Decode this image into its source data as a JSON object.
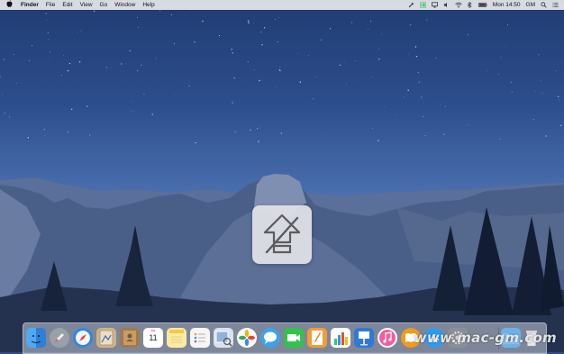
{
  "menubar": {
    "apple_glyph": "",
    "items": [
      "Finder",
      "File",
      "Edit",
      "View",
      "Go",
      "Window",
      "Help"
    ],
    "clock": "Mon 14:50",
    "user": "GM",
    "status_icons": [
      "tool-icon",
      "sidebar-app-icon",
      "airplay-icon",
      "volume-icon",
      "wifi-icon",
      "bluetooth-icon",
      "battery-icon"
    ]
  },
  "hud": {
    "icon": "upload-disabled-icon"
  },
  "dock": {
    "apps": [
      "finder",
      "launchpad",
      "safari",
      "mail-stamp",
      "contacts",
      "calendar",
      "notes",
      "reminders",
      "preview",
      "photos",
      "messages",
      "facetime",
      "pages",
      "numbers",
      "keynote",
      "itunes",
      "ibooks",
      "app-store",
      "system-preferences",
      "downloads-folder",
      "trash"
    ],
    "calendar": {
      "month": "JUL",
      "day": "11"
    }
  },
  "watermark": "www.mac-gm.com",
  "colors": {
    "accent": "#3fae5f",
    "sky": "#2d4e8c",
    "hud": "#e2e2e6"
  }
}
